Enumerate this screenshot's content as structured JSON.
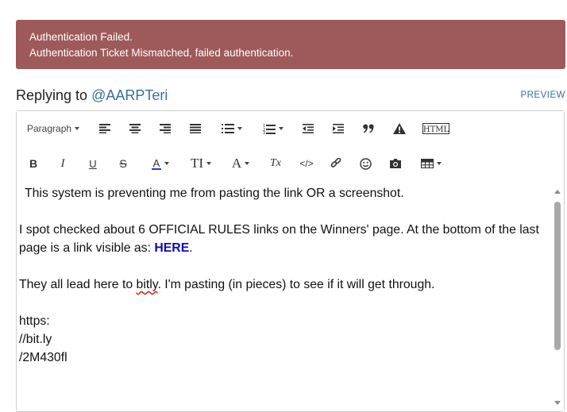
{
  "alert": {
    "line1": "Authentication Failed.",
    "line2": "Authentication Ticket Mismatched, failed authentication.",
    "background": "#9e5a5a"
  },
  "reply": {
    "prefix": "Replying to",
    "handle": "@AARPTeri",
    "preview_label": "PREVIEW"
  },
  "toolbar": {
    "paragraph_label": "Paragraph",
    "row1_icons": [
      "align-left-icon",
      "align-center-icon",
      "align-right-icon",
      "align-justify-icon",
      "bulleted-list-icon",
      "numbered-list-icon",
      "outdent-icon",
      "indent-icon",
      "blockquote-icon",
      "warning-icon",
      "html-icon"
    ],
    "row2_icons": [
      "bold-icon",
      "italic-icon",
      "underline-icon",
      "strikethrough-icon",
      "text-color-icon",
      "font-size-icon",
      "font-family-icon",
      "clear-format-icon",
      "code-icon",
      "link-icon",
      "emoji-icon",
      "camera-icon",
      "table-icon"
    ],
    "html_label": "HTML",
    "bold_label": "B",
    "italic_label": "I",
    "underline_label": "U",
    "strike_label": "S",
    "color_label": "A",
    "fontsize_label": "TI",
    "fontfamily_label": "A",
    "clear_label": "Tx",
    "code_label": "</>",
    "quote_label": "99",
    "accent_color": "#3a6f95",
    "text_color_underline": "#1a3fd6"
  },
  "content": {
    "line1": "This system is preventing me from pasting the link OR a screenshot.",
    "line2": "I spot checked about 6 OFFICIAL RULES links on the Winners' page. At the bottom of the last",
    "line3_prefix": "page is a link visible as: ",
    "line3_link": "HERE",
    "line3_suffix": ".",
    "line4_prefix": "They all lead here to ",
    "line4_misspelled": "bitly",
    "line4_suffix": ". I'm pasting (in pieces) to see if it will get through.",
    "line5": "https:",
    "line6": "//bit.ly",
    "line7": "/2M430fl"
  }
}
